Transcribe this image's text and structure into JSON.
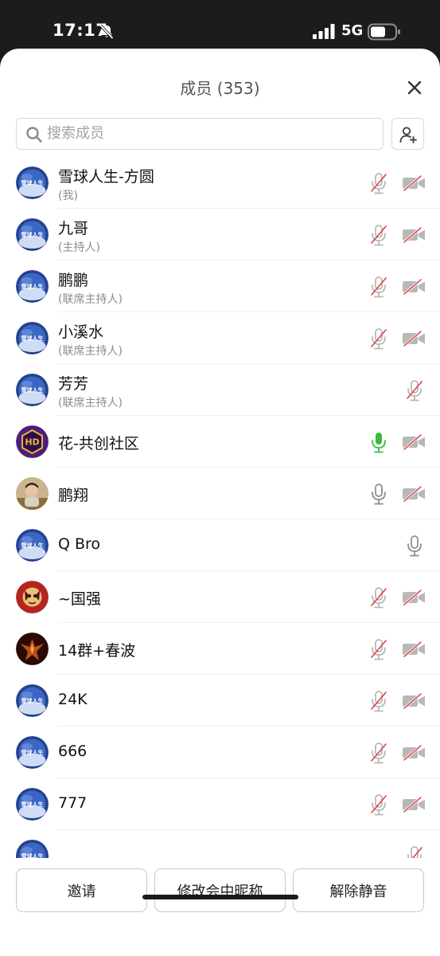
{
  "status_bar": {
    "time": "17:17",
    "network": "5G",
    "icons": [
      "bell-slash-icon",
      "signal-icon",
      "battery-icon"
    ]
  },
  "sheet": {
    "title": "成员 (353)",
    "close_icon": "close-icon"
  },
  "search": {
    "placeholder": "搜索成员",
    "value": "",
    "add_member_icon": "add-person-icon"
  },
  "members": [
    {
      "name": "雪球人生-方圆",
      "role": "(我)",
      "avatar": "snowball-logo",
      "mic": "muted",
      "camera": "off"
    },
    {
      "name": "九哥",
      "role": "(主持人)",
      "avatar": "snowball-logo",
      "mic": "muted",
      "camera": "off"
    },
    {
      "name": "鹏鹏",
      "role": "(联席主持人)",
      "avatar": "snowball-logo",
      "mic": "muted",
      "camera": "off"
    },
    {
      "name": "小溪水",
      "role": "(联席主持人)",
      "avatar": "snowball-logo",
      "mic": "muted",
      "camera": "off"
    },
    {
      "name": "芳芳",
      "role": "(联席主持人)",
      "avatar": "snowball-logo",
      "mic": "muted",
      "camera": "none"
    },
    {
      "name": "花-共创社区",
      "role": "",
      "avatar": "hd-hexagon-logo",
      "mic": "speaking",
      "camera": "off"
    },
    {
      "name": "鹏翔",
      "role": "",
      "avatar": "child-photo",
      "mic": "on",
      "camera": "off"
    },
    {
      "name": "Q Bro",
      "role": "",
      "avatar": "snowball-logo",
      "mic": "on",
      "camera": "none"
    },
    {
      "name": "~国强",
      "role": "",
      "avatar": "red-art-avatar",
      "mic": "muted",
      "camera": "off"
    },
    {
      "name": "14群+春波",
      "role": "",
      "avatar": "phoenix-avatar",
      "mic": "muted",
      "camera": "off"
    },
    {
      "name": "24K",
      "role": "",
      "avatar": "snowball-logo",
      "mic": "muted",
      "camera": "off"
    },
    {
      "name": "666",
      "role": "",
      "avatar": "snowball-logo",
      "mic": "muted",
      "camera": "off"
    },
    {
      "name": "777",
      "role": "",
      "avatar": "snowball-logo",
      "mic": "muted",
      "camera": "off"
    },
    {
      "name": "",
      "role": "",
      "avatar": "snowball-logo",
      "mic": "muted",
      "camera": "none"
    }
  ],
  "bottom_buttons": {
    "invite": "邀请",
    "rename": "修改会中昵称",
    "unmute": "解除静音"
  },
  "colors": {
    "mic_speaking": "#3dbb3d",
    "muted_slash": "#e04848",
    "icon_gray": "#8e8e8e",
    "border": "#d9d9d9"
  },
  "avatar_texts": {
    "snowball": "雪球人生",
    "hd": "HD"
  }
}
